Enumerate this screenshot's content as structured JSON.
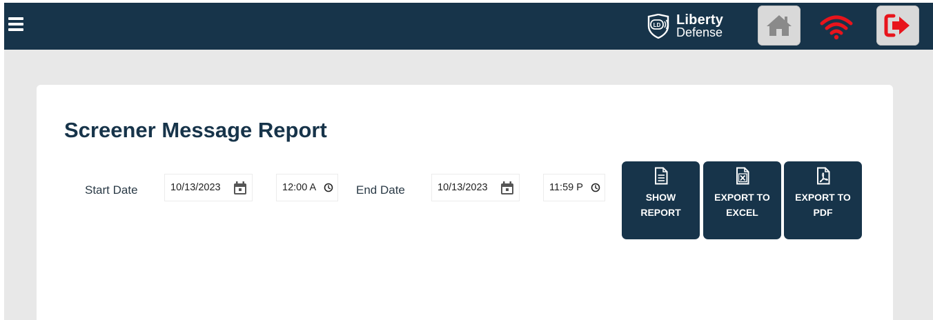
{
  "header": {
    "logo_line1": "Liberty",
    "logo_line2": "Defense",
    "logo_badge": "LD"
  },
  "report": {
    "title": "Screener Message Report",
    "start_label": "Start Date",
    "start_date": "10/13/2023",
    "start_time": "12:00 A",
    "end_label": "End Date",
    "end_date": "10/13/2023",
    "end_time": "11:59 P"
  },
  "actions": {
    "show_report": "SHOW\nREPORT",
    "export_excel": "EXPORT TO\nEXCEL",
    "export_pdf": "EXPORT TO\nPDF"
  },
  "icons": {
    "menu": "hamburger-menu-icon",
    "home": "home-icon",
    "wifi": "wifi-icon",
    "logout": "logout-icon",
    "calendar": "calendar-icon",
    "clock": "clock-icon",
    "document": "document-icon",
    "excel": "excel-file-icon",
    "pdf": "pdf-file-icon"
  },
  "colors": {
    "navy": "#17344a",
    "page_bg": "#e8e8e8",
    "wifi_red": "#e8141c",
    "logout_red": "#e8141c",
    "button_gray": "#d9d9d9"
  }
}
